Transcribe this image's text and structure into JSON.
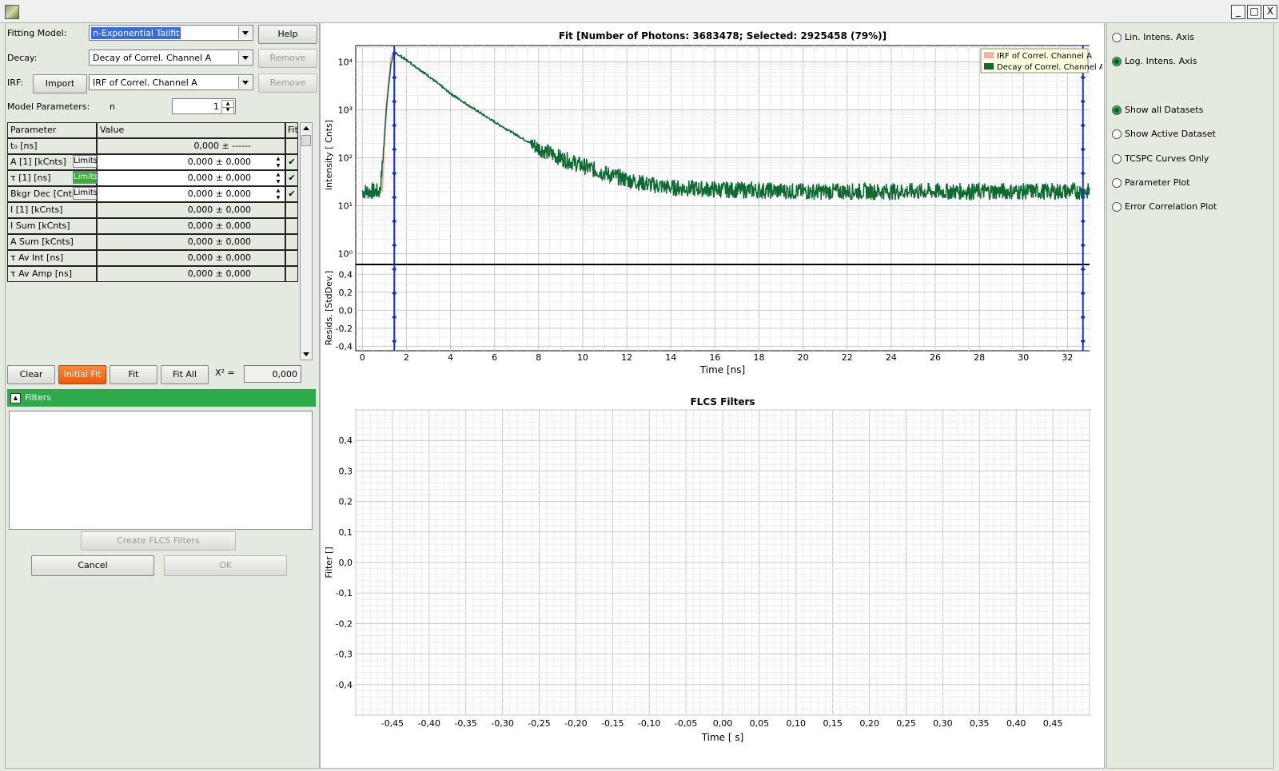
{
  "window": {
    "min": "_",
    "max": "□",
    "close": "X"
  },
  "left": {
    "fitting_model_label": "Fitting Model:",
    "fitting_model_value": "n-Exponential Tailfit",
    "help_label": "Help",
    "decay_label": "Decay:",
    "decay_value": "Decay of Correl. Channel A",
    "remove_label": "Remove",
    "irf_label": "IRF:",
    "import_label": "Import",
    "irf_value": "IRF of Correl. Channel A",
    "model_params_label": "Model Parameters:",
    "n_label": "n",
    "n_value": "1",
    "table": {
      "col_param": "Parameter",
      "col_value": "Value",
      "col_fit": "Fit",
      "limits_label": "Limits",
      "rows": [
        {
          "name": "t₀ [ns]",
          "value": "0,000  ± ------",
          "limits": false,
          "fit": ""
        },
        {
          "name": "A [1] [kCnts]",
          "value": "0,000 ± 0,000",
          "limits": true,
          "fit": "✔"
        },
        {
          "name": "τ [1] [ns]",
          "value": "0,000 ± 0,000",
          "limits": true,
          "fit": "✔"
        },
        {
          "name": "Bkgr Dec [Cnts]",
          "value": "0,000 ± 0,000",
          "limits": true,
          "fit": "✔"
        },
        {
          "name": "I [1] [kCnts]",
          "value": "0,000 ± 0,000",
          "limits": false,
          "fit": ""
        },
        {
          "name": "I Sum [kCnts]",
          "value": "0,000 ± 0,000",
          "limits": false,
          "fit": ""
        },
        {
          "name": "A Sum [kCnts]",
          "value": "0,000 ± 0,000",
          "limits": false,
          "fit": ""
        },
        {
          "name": "τ Av Int [ns]",
          "value": "0,000 ± 0,000",
          "limits": false,
          "fit": ""
        },
        {
          "name": "τ Av Amp [ns]",
          "value": "0,000 ± 0,000",
          "limits": false,
          "fit": ""
        }
      ]
    },
    "clear_label": "Clear",
    "initial_fit_label": "Initial Fit",
    "fit_label": "Fit",
    "fit_all_label": "Fit All",
    "chi2_label": "X² =",
    "chi2_value": "0,000",
    "filters_label": "Filters",
    "create_filters_label": "Create FLCS Filters",
    "cancel_label": "Cancel",
    "ok_label": "OK"
  },
  "right": {
    "options": [
      {
        "label": "Lin. Intens. Axis",
        "checked": false
      },
      {
        "label": "Log. Intens. Axis",
        "checked": true
      },
      {
        "label": "Show all Datasets",
        "checked": true
      },
      {
        "label": "Show Active Dataset",
        "checked": false
      },
      {
        "label": "TCSPC Curves Only",
        "checked": false
      },
      {
        "label": "Parameter Plot",
        "checked": false
      },
      {
        "label": "Error Correlation Plot",
        "checked": false
      }
    ]
  },
  "chart_data": [
    {
      "type": "line",
      "title": "Fit [Number of Photons: 3683478; Selected: 2925458 (79%)]",
      "xlabel": "Time [ns]",
      "ylabel": "Intensity [ Cnts]",
      "xlim": [
        -0.3,
        33
      ],
      "ylim": [
        0.6,
        22000
      ],
      "yscale": "log",
      "x_ticks": [
        "0",
        "2",
        "4",
        "6",
        "8",
        "10",
        "12",
        "14",
        "16",
        "18",
        "20",
        "22",
        "24",
        "26",
        "28",
        "30",
        "32"
      ],
      "y_ticks": [
        "10⁰",
        "10¹",
        "10²",
        "10³",
        "10⁴"
      ],
      "legend": "top-right",
      "series": [
        {
          "name": "IRF of Correl. Channel A",
          "color": "#f3b0b0"
        },
        {
          "name": "Decay of Correl. Channel A",
          "color": "#0e6a30",
          "x": [
            0,
            0.8,
            0.9,
            1.1,
            1.3,
            1.45,
            2,
            3,
            4,
            5,
            6,
            7,
            8,
            9,
            10,
            11,
            12,
            13,
            14,
            16,
            20,
            25,
            30,
            33
          ],
          "y": [
            20,
            20,
            60,
            1200,
            9000,
            16000,
            11000,
            5100,
            2200,
            1100,
            560,
            300,
            160,
            100,
            68,
            48,
            35,
            28,
            24,
            22,
            20,
            20,
            20,
            20
          ]
        }
      ],
      "markers_x": [
        1.45,
        32.7
      ],
      "marker_color": "#1030e0",
      "grid": true
    },
    {
      "type": "line",
      "title": "",
      "xlabel": "",
      "ylabel": "Resids. [StdDev.]",
      "xlim": [
        -0.3,
        33
      ],
      "ylim": [
        -0.45,
        0.5
      ],
      "y_ticks": [
        "0,4",
        "0,2",
        "0,0",
        "-0,2",
        "-0,4"
      ],
      "grid": true
    },
    {
      "type": "line",
      "title": "FLCS Filters",
      "xlabel": "Time [ s]",
      "ylabel": "Filter []",
      "xlim": [
        -0.5,
        0.5
      ],
      "ylim": [
        -0.5,
        0.5
      ],
      "x_ticks": [
        "-0,45",
        "-0,40",
        "-0,35",
        "-0,30",
        "-0,25",
        "-0,20",
        "-0,15",
        "-0,10",
        "-0,05",
        "0,00",
        "0,05",
        "0,10",
        "0,15",
        "0,20",
        "0,25",
        "0,30",
        "0,35",
        "0,40",
        "0,45"
      ],
      "y_ticks": [
        "0,4",
        "0,3",
        "0,2",
        "0,1",
        "0,0",
        "-0,1",
        "-0,2",
        "-0,3",
        "-0,4"
      ],
      "grid": true
    }
  ]
}
